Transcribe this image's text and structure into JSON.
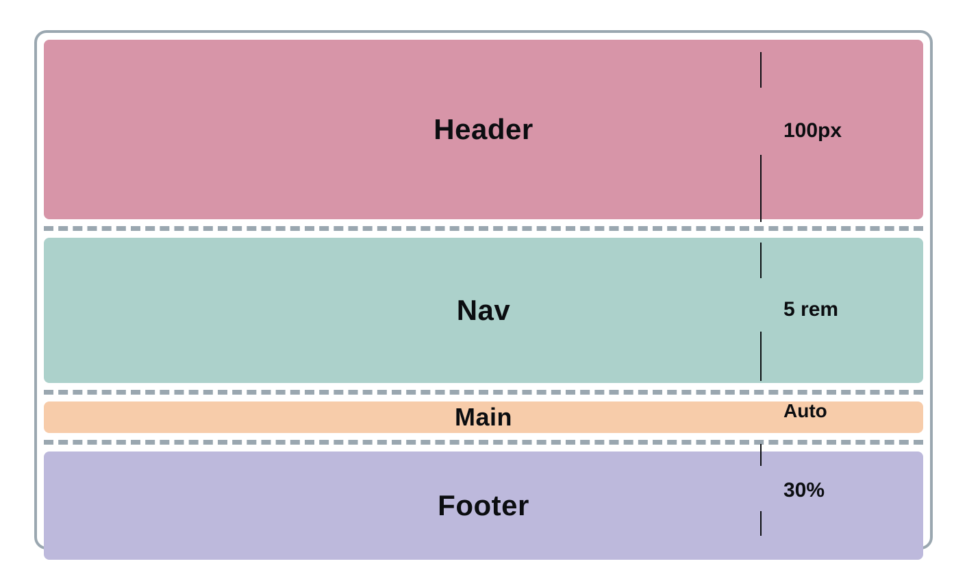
{
  "rows": {
    "header": {
      "label": "Header",
      "measure": "100px"
    },
    "nav": {
      "label": "Nav",
      "measure": "5 rem"
    },
    "main": {
      "label": "Main",
      "measure": "Auto"
    },
    "footer": {
      "label": "Footer",
      "measure": "30%"
    }
  }
}
